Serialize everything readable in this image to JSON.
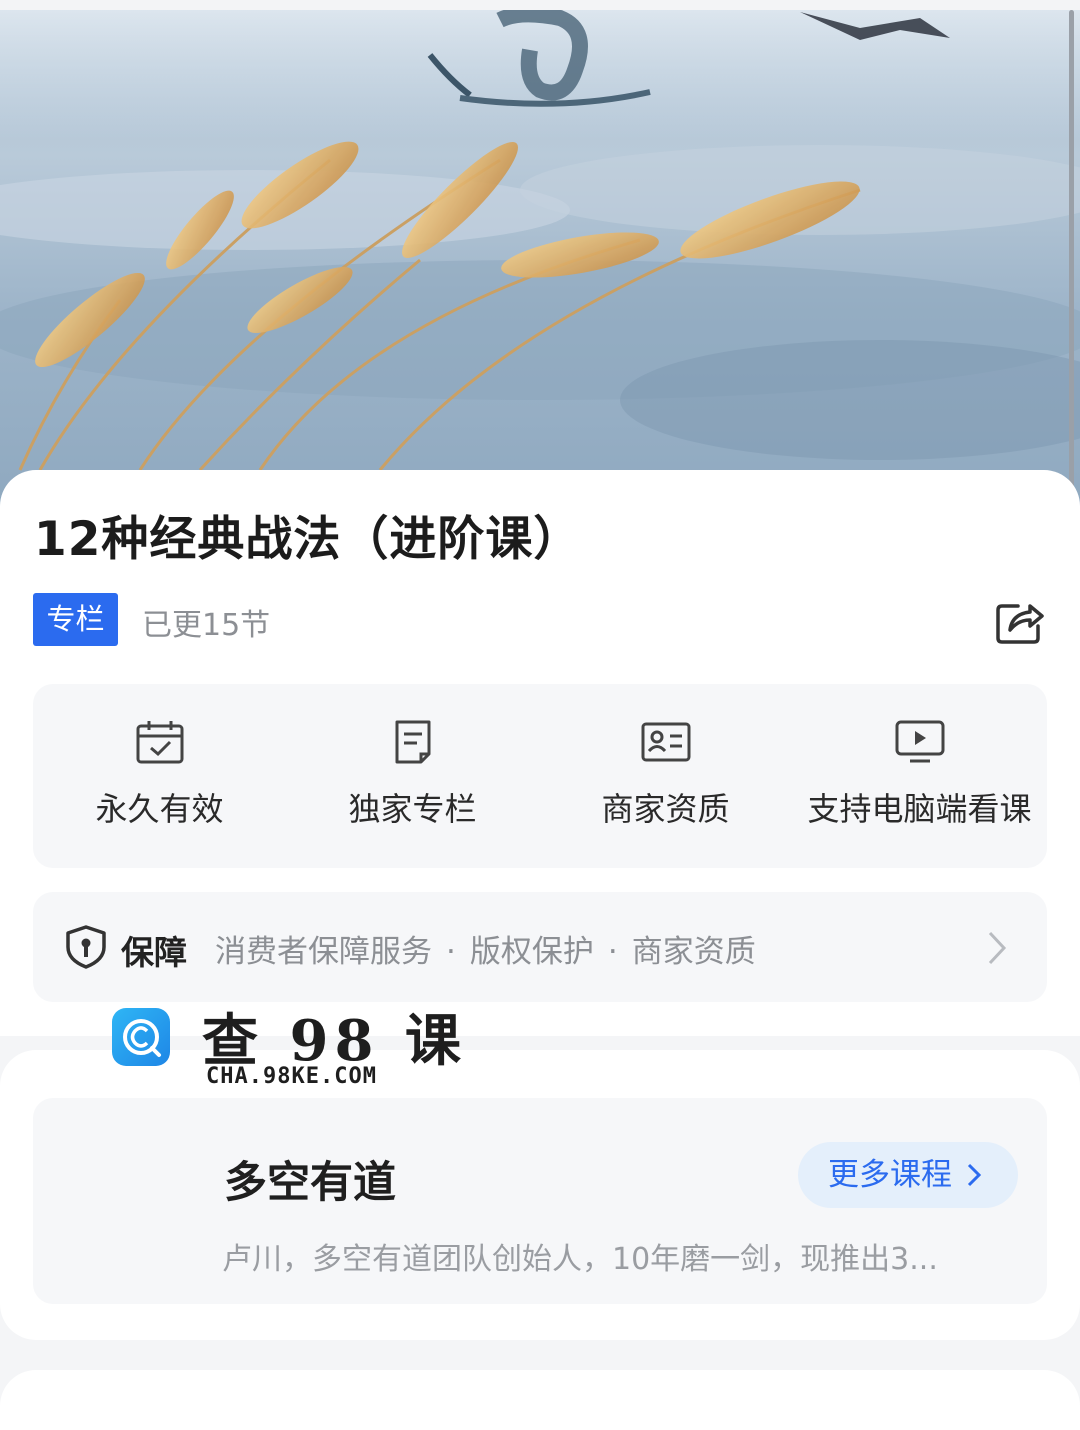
{
  "course": {
    "title": "12种经典战法（进阶课）",
    "badge": "专栏",
    "updated": "已更15节"
  },
  "features": [
    {
      "label": "永久有效",
      "icon": "calendar-check-icon"
    },
    {
      "label": "独家专栏",
      "icon": "document-icon"
    },
    {
      "label": "商家资质",
      "icon": "id-card-icon"
    },
    {
      "label": "支持电脑端看课",
      "icon": "monitor-play-icon"
    }
  ],
  "guarantee": {
    "title": "保障",
    "items": [
      "消费者保障服务",
      "版权保护",
      "商家资质"
    ],
    "separator": "·"
  },
  "watermark": {
    "title": "查 98 课",
    "subtitle": "CHA.98KE.COM"
  },
  "author": {
    "name": "多空有道",
    "more_label": "更多课程",
    "description": "卢川，多空有道团队创始人，10年磨一剑，现推出3..."
  },
  "colors": {
    "accent": "#2b6bef",
    "badge_bg": "#2b6bef",
    "more_bg": "#e4effb",
    "muted_text": "#8c8f94"
  }
}
